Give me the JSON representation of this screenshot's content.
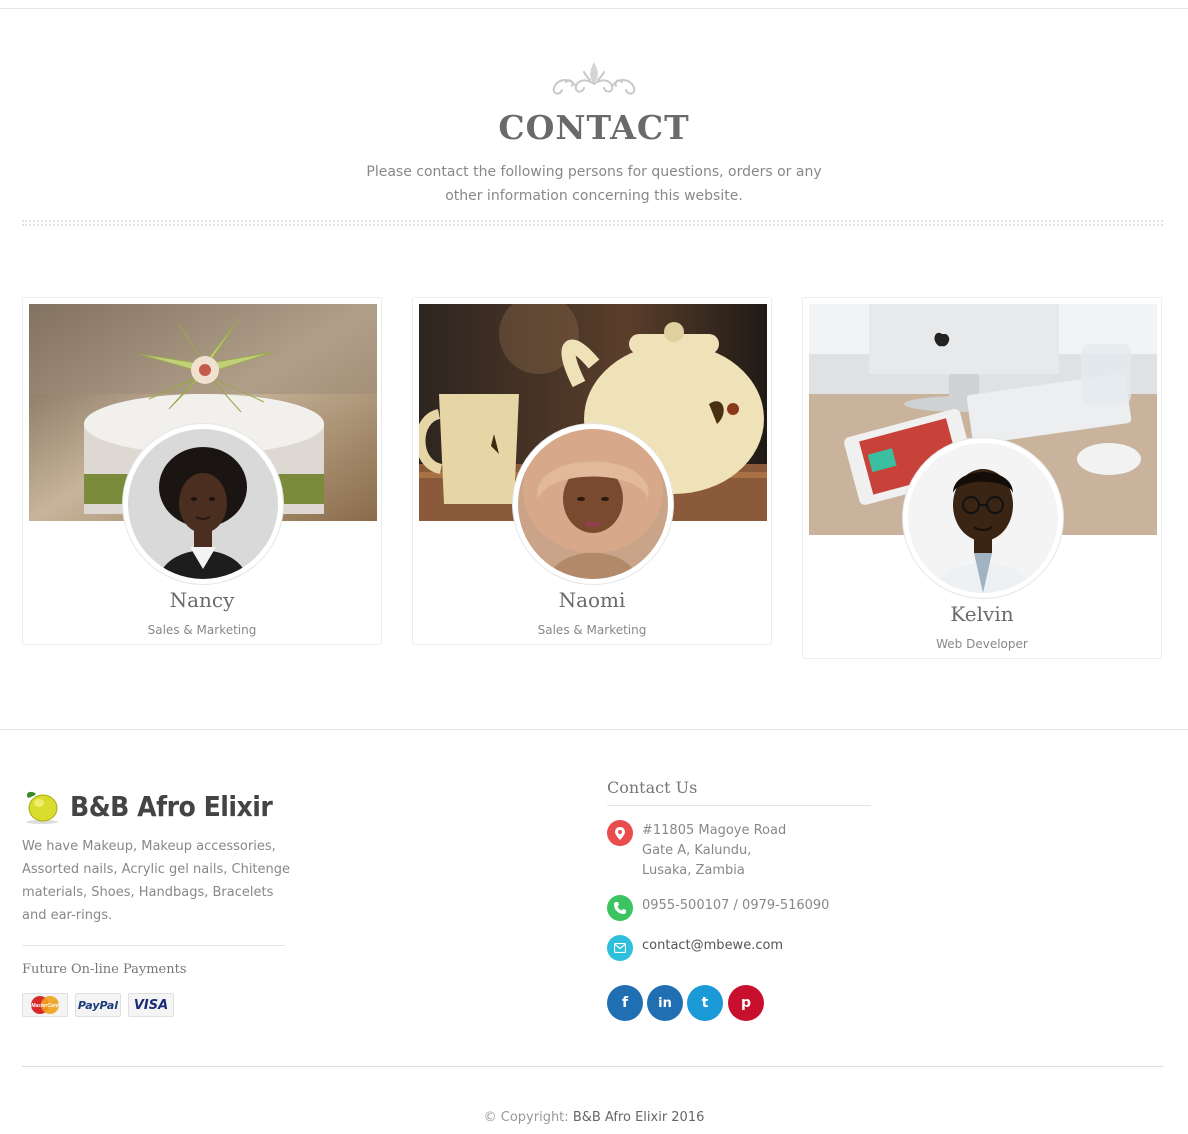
{
  "section": {
    "title": "CONTACT",
    "intro": "Please contact the following persons for questions, orders or any other information concerning this website."
  },
  "team": [
    {
      "name": "Nancy",
      "role": "Sales & Marketing",
      "cover_icon": "cake-photo",
      "avatar_icon": "woman-portrait"
    },
    {
      "name": "Naomi",
      "role": "Sales & Marketing",
      "cover_icon": "teapot-photo",
      "avatar_icon": "woman-portrait"
    },
    {
      "name": "Kelvin",
      "role": "Web Developer",
      "cover_icon": "desk-computer-photo",
      "avatar_icon": "man-portrait"
    }
  ],
  "footer": {
    "brand": {
      "name": "B&B Afro Elixir",
      "logo_icon": "lemon-icon"
    },
    "about": "We have Makeup, Makeup accessories, Assorted nails, Acrylic gel nails, Chitenge materials, Shoes, Handbags, Bracelets and ear-rings.",
    "payments": {
      "title": "Future On-line Payments",
      "methods": [
        "MasterCard",
        "PayPal",
        "VISA"
      ]
    },
    "contact": {
      "title": "Contact Us",
      "address": [
        "#11805 Magoye Road",
        "Gate A, Kalundu,",
        "Lusaka, Zambia"
      ],
      "phone": "0955-500107 / 0979-516090",
      "email": "contact@mbewe.com"
    },
    "social": [
      {
        "name": "facebook",
        "glyph": "f",
        "color": "#1f6fb2"
      },
      {
        "name": "linkedin",
        "glyph": "in",
        "color": "#1f6fb2"
      },
      {
        "name": "twitter",
        "glyph": "t",
        "color": "#1a9bd7"
      },
      {
        "name": "pinterest",
        "glyph": "p",
        "color": "#c8102e"
      }
    ],
    "copyright_prefix": "© Copyright:",
    "copyright_owner": "B&B Afro Elixir 2016"
  },
  "colors": {
    "address_icon": "#e84c4c",
    "phone_icon": "#3cc463",
    "email_icon": "#2ebfdc"
  }
}
